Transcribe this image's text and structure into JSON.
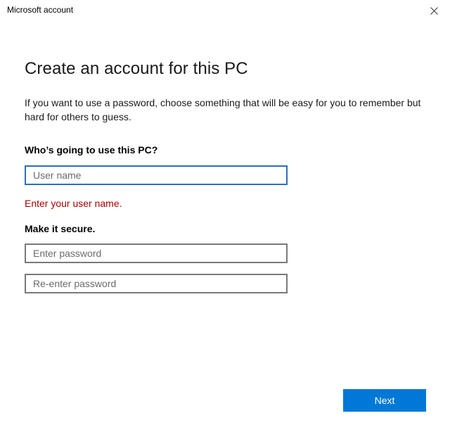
{
  "window": {
    "title": "Microsoft account"
  },
  "page": {
    "heading": "Create an account for this PC",
    "intro": "If you want to use a password, choose something that will be easy for you to remember but hard for others to guess."
  },
  "user_section": {
    "label": "Who’s going to use this PC?",
    "username_placeholder": "User name",
    "username_value": "",
    "error": "Enter your user name."
  },
  "secure_section": {
    "label": "Make it secure.",
    "password_placeholder": "Enter password",
    "reenter_placeholder": "Re-enter password"
  },
  "actions": {
    "next_label": "Next"
  },
  "colors": {
    "accent": "#0078d7",
    "focus_border": "#2a6fc1",
    "error": "#a80000"
  },
  "icons": {
    "close": "close-icon"
  }
}
